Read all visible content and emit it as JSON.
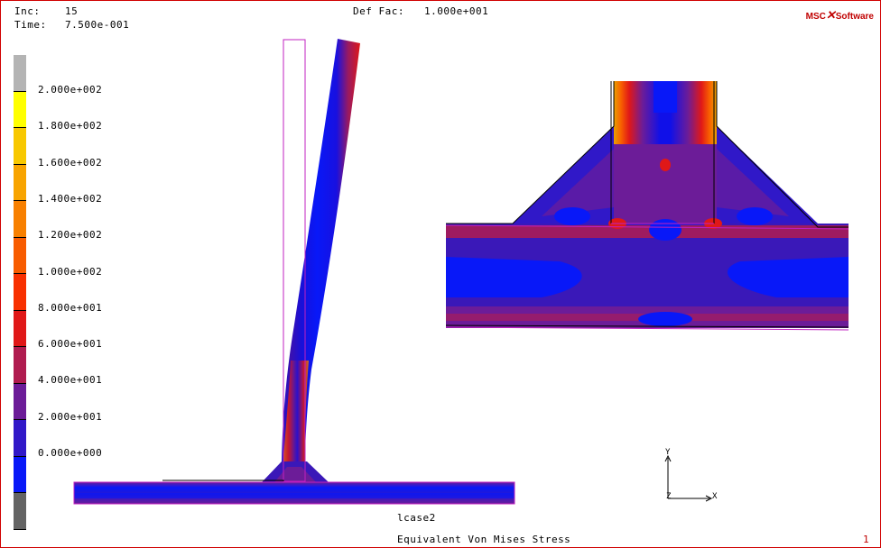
{
  "header": {
    "inc_label": "Inc:",
    "inc_value": "15",
    "time_label": "Time:",
    "time_value": "7.500e-001",
    "deffac_label": "Def Fac:",
    "deffac_value": "1.000e+001"
  },
  "logo": {
    "left": "MSC",
    "right": "Software"
  },
  "legend": {
    "colors": [
      "#b4b4b4",
      "#ffff00",
      "#f8c800",
      "#f8a400",
      "#f88000",
      "#f85c00",
      "#f83000",
      "#e01818",
      "#b01c50",
      "#6c1c98",
      "#3018c8",
      "#0818f8",
      "#646464"
    ],
    "labels": [
      "2.000e+002",
      "1.800e+002",
      "1.600e+002",
      "1.400e+002",
      "1.200e+002",
      "1.000e+002",
      "8.000e+001",
      "6.000e+001",
      "4.000e+001",
      "2.000e+001",
      "0.000e+000"
    ]
  },
  "triad": {
    "x": "X",
    "y": "Y",
    "z": "Z"
  },
  "footer": {
    "loadcase": "lcase2",
    "quantity": "Equivalent Von Mises Stress",
    "index": "1"
  }
}
